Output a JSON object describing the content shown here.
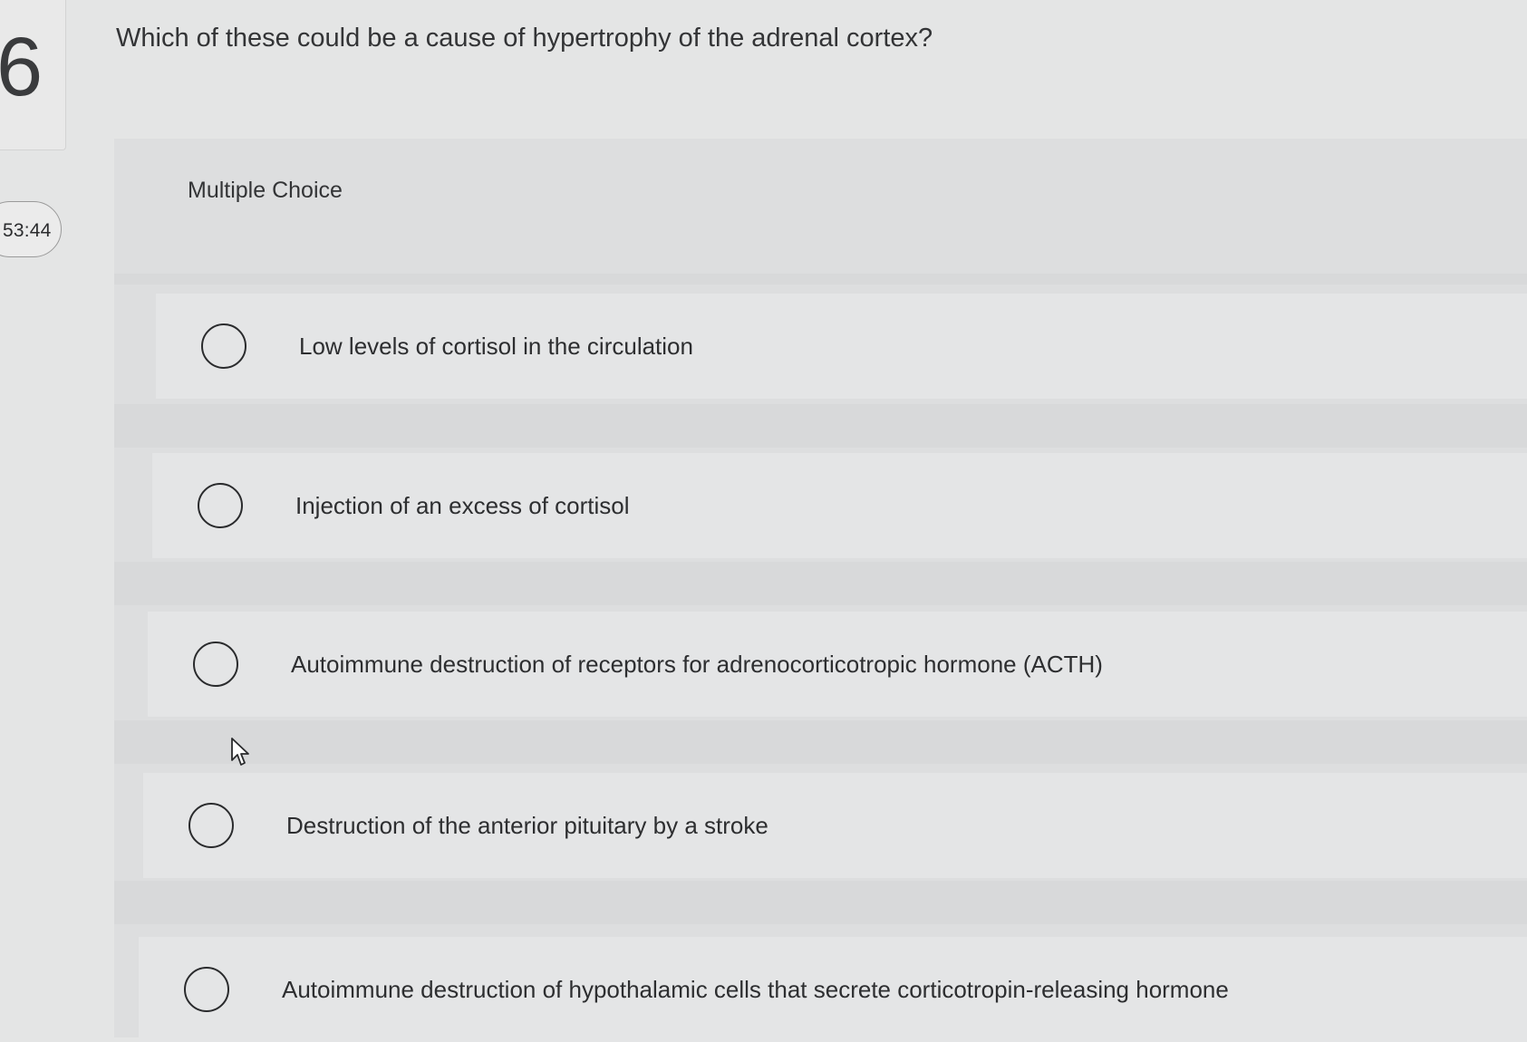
{
  "sidebar": {
    "question_number": "6",
    "timer": "53:44"
  },
  "question": {
    "text": "Which of these could be a cause of hypertrophy of the adrenal cortex?"
  },
  "choices": {
    "section_label": "Multiple Choice",
    "options": [
      {
        "label": "Low levels of cortisol in the circulation",
        "selected": false
      },
      {
        "label": "Injection of an excess of cortisol",
        "selected": false
      },
      {
        "label": "Autoimmune destruction of receptors for adrenocorticotropic hormone (ACTH)",
        "selected": false
      },
      {
        "label": "Destruction of the anterior pituitary by a stroke",
        "selected": false
      },
      {
        "label": "Autoimmune destruction of hypothalamic cells that secrete corticotropin-releasing hormone",
        "selected": false
      }
    ]
  },
  "icons": {
    "cursor": "mouse-pointer-icon",
    "radio": "radio-unchecked-icon"
  },
  "colors": {
    "background": "#e4e5e5",
    "text": "#2b2c2e"
  }
}
